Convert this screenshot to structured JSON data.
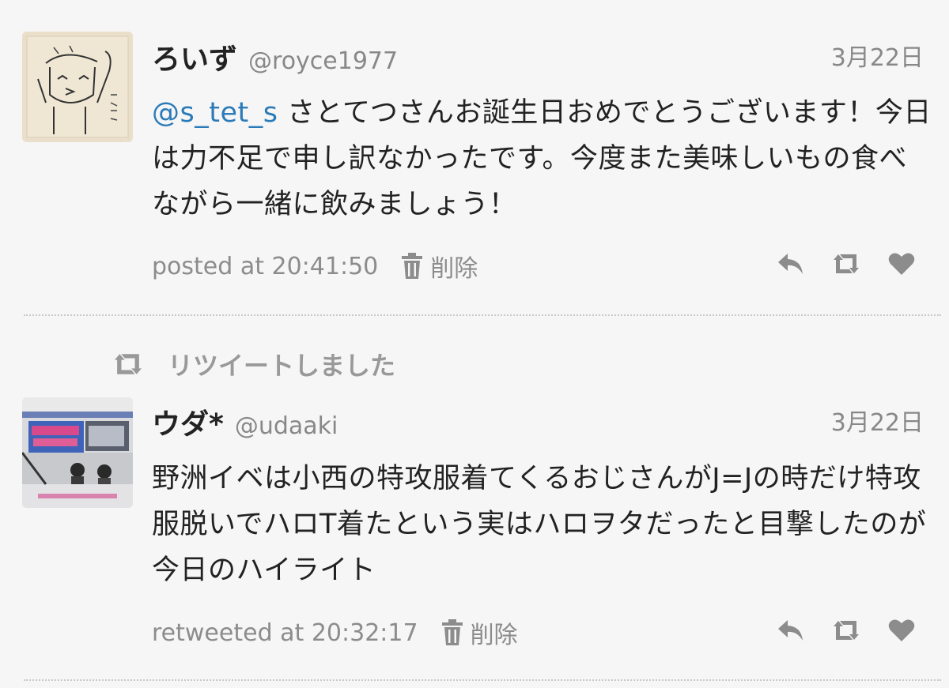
{
  "tweets": [
    {
      "name": "ろいず",
      "handle": "@royce1977",
      "date": "3月22日",
      "mention": "@s_tet_s",
      "text": " さとてつさんお誕生日おめでとうございます！今日は力不足で申し訳なかったです。今度また美味しいもの食べながら一緒に飲みましょう！",
      "meta": "posted at 20:41:50",
      "delete_label": "削除"
    },
    {
      "name": "ウダ*",
      "handle": "@udaaki",
      "date": "3月22日",
      "text": "野洲イベは小西の特攻服着てくるおじさんがJ=Jの時だけ特攻服脱いでハロT着たという実はハロヲタだったと目撃したのが今日のハイライト",
      "meta": "retweeted at 20:32:17",
      "delete_label": "削除"
    }
  ],
  "retweet_banner": "リツイートしました",
  "colors": {
    "mention": "#2b7bb9",
    "meta": "#8c8c8c",
    "background": "#f7f6f6"
  },
  "icons": [
    "trash-icon",
    "reply-icon",
    "retweet-icon",
    "heart-icon"
  ]
}
